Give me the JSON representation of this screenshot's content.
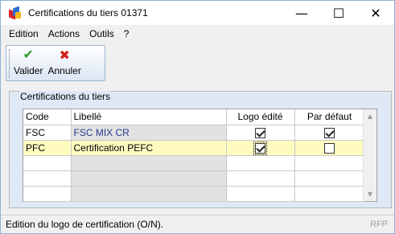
{
  "window": {
    "title": "Certifications du tiers 01371",
    "icon": "app-logo-icon",
    "controls": {
      "minimize": "—",
      "maximize": "☐",
      "close": "✕"
    }
  },
  "menu": {
    "items": [
      "Edition",
      "Actions",
      "Outils",
      "?"
    ]
  },
  "toolbar": {
    "validate_label": "Valider",
    "validate_icon": "checkmark-icon",
    "cancel_label": "Annuler",
    "cancel_icon": "cross-icon"
  },
  "group": {
    "title": "Certifications du tiers"
  },
  "table": {
    "columns": [
      "Code",
      "Libellé",
      "Logo édité",
      "Par défaut"
    ],
    "rows": [
      {
        "code": "FSC",
        "libelle": "FSC MIX CR",
        "logo_edite": true,
        "par_defaut": true
      },
      {
        "code": "PFC",
        "libelle": "Certification PEFC",
        "logo_edite": true,
        "par_defaut": false
      }
    ]
  },
  "status": {
    "text": "Edition du logo de certification (O/N).",
    "code": "RFP"
  },
  "colors": {
    "selected_row": "#fffbbf",
    "group_background": "#dfe9f5",
    "validate_icon": "#2e9e2e",
    "cancel_icon": "#d42020"
  }
}
